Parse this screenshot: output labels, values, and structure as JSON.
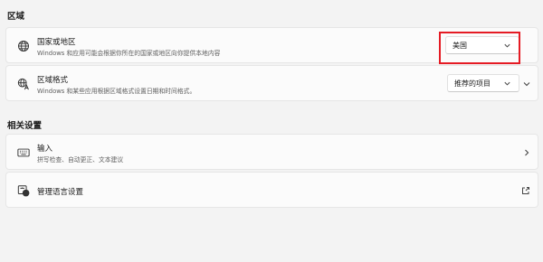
{
  "region": {
    "heading": "区域",
    "country": {
      "title": "国家或地区",
      "subtitle": "Windows 和应用可能会根据你所在的国家或地区向你提供本地内容",
      "selected": "美国",
      "icon": "globe-icon"
    },
    "format": {
      "title": "区域格式",
      "subtitle": "Windows 和某些应用根据区域格式设置日期和时间格式。",
      "selected": "推荐的项目",
      "icon": "region-format-icon"
    }
  },
  "related": {
    "heading": "相关设置",
    "input": {
      "title": "输入",
      "subtitle": "拼写检查、自动更正、文本建议",
      "icon": "keyboard-icon"
    },
    "language": {
      "title": "管理语言设置",
      "icon": "language-icon"
    }
  },
  "colors": {
    "background": "#f3f3f3",
    "card": "#fbfbfb",
    "highlight": "#e51b24"
  }
}
